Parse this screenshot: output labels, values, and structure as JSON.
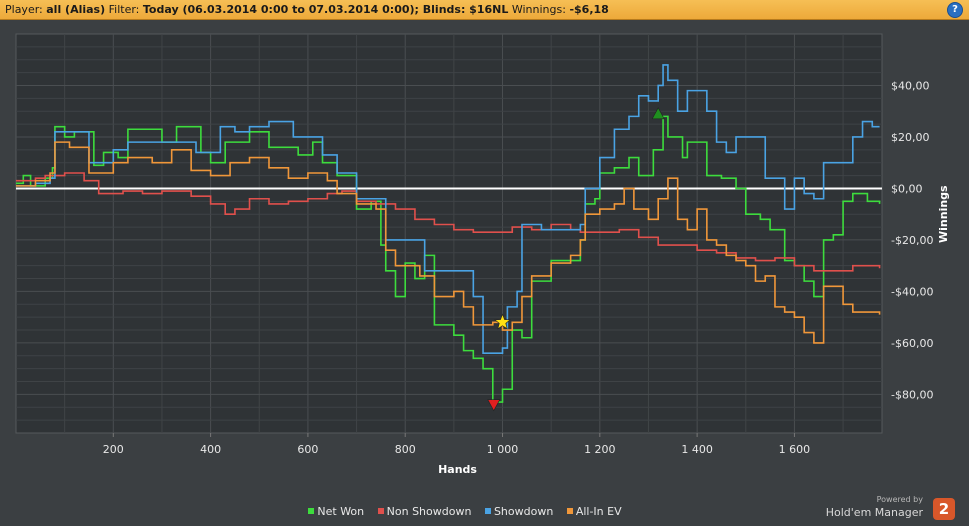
{
  "header": {
    "player_label": "Player:",
    "player_value": "all (Alias)",
    "filter_label": "Filter:",
    "filter_value": "Today (06.03.2014 0:00 to 07.03.2014 0:00); Blinds: $16NL",
    "winnings_label": "Winnings:",
    "winnings_value": "-$6,18",
    "help_glyph": "?"
  },
  "branding": {
    "powered": "Powered by",
    "name": "Hold'em Manager",
    "logo": "2"
  },
  "chart_data": {
    "type": "line",
    "xlabel": "Hands",
    "ylabel": "Winnings",
    "xlim": [
      0,
      1780
    ],
    "ylim": [
      -95,
      60
    ],
    "xticks": [
      200,
      400,
      600,
      800,
      1000,
      1200,
      1400,
      1600
    ],
    "xtick_labels": [
      "200",
      "400",
      "600",
      "800",
      "1 000",
      "1 200",
      "1 400",
      "1 600"
    ],
    "yticks": [
      40,
      20,
      0,
      -20,
      -40,
      -60,
      -80
    ],
    "ytick_labels": [
      "$40,00",
      "$20,00",
      "$0,00",
      "-$20,00",
      "-$40,00",
      "-$60,00",
      "-$80,00"
    ],
    "grid": true,
    "legend_position": "bottom-center",
    "series": [
      {
        "name": "Net Won",
        "color": "#3ddc3d",
        "points": [
          [
            0,
            2
          ],
          [
            15,
            5
          ],
          [
            30,
            1
          ],
          [
            60,
            4
          ],
          [
            75,
            8
          ],
          [
            80,
            24
          ],
          [
            100,
            20
          ],
          [
            120,
            22
          ],
          [
            160,
            9
          ],
          [
            180,
            14
          ],
          [
            210,
            12
          ],
          [
            230,
            23
          ],
          [
            300,
            18
          ],
          [
            330,
            24
          ],
          [
            380,
            14
          ],
          [
            400,
            10
          ],
          [
            430,
            18
          ],
          [
            480,
            22
          ],
          [
            520,
            16
          ],
          [
            580,
            13
          ],
          [
            610,
            18
          ],
          [
            630,
            10
          ],
          [
            660,
            5
          ],
          [
            700,
            -8
          ],
          [
            730,
            -5
          ],
          [
            750,
            -22
          ],
          [
            760,
            -32
          ],
          [
            780,
            -42
          ],
          [
            800,
            -29
          ],
          [
            820,
            -35
          ],
          [
            840,
            -26
          ],
          [
            860,
            -53
          ],
          [
            900,
            -57
          ],
          [
            920,
            -63
          ],
          [
            940,
            -66
          ],
          [
            960,
            -70
          ],
          [
            980,
            -83
          ],
          [
            1000,
            -78
          ],
          [
            1020,
            -55
          ],
          [
            1040,
            -58
          ],
          [
            1060,
            -36
          ],
          [
            1100,
            -28
          ],
          [
            1130,
            -28
          ],
          [
            1160,
            -20
          ],
          [
            1170,
            -6
          ],
          [
            1190,
            -4
          ],
          [
            1200,
            6
          ],
          [
            1230,
            8
          ],
          [
            1260,
            12
          ],
          [
            1280,
            5
          ],
          [
            1310,
            15
          ],
          [
            1330,
            28
          ],
          [
            1340,
            20
          ],
          [
            1370,
            12
          ],
          [
            1380,
            18
          ],
          [
            1420,
            5
          ],
          [
            1450,
            4
          ],
          [
            1480,
            0
          ],
          [
            1500,
            -10
          ],
          [
            1530,
            -12
          ],
          [
            1550,
            -16
          ],
          [
            1580,
            -28
          ],
          [
            1600,
            -30
          ],
          [
            1620,
            -36
          ],
          [
            1640,
            -42
          ],
          [
            1660,
            -20
          ],
          [
            1680,
            -18
          ],
          [
            1700,
            -5
          ],
          [
            1720,
            -2
          ],
          [
            1750,
            -5
          ],
          [
            1775,
            -6
          ]
        ]
      },
      {
        "name": "Non Showdown",
        "color": "#e0504c",
        "points": [
          [
            0,
            3
          ],
          [
            40,
            4
          ],
          [
            60,
            5
          ],
          [
            100,
            6
          ],
          [
            140,
            3
          ],
          [
            170,
            -2
          ],
          [
            220,
            -1
          ],
          [
            260,
            -2
          ],
          [
            300,
            -1
          ],
          [
            360,
            -3
          ],
          [
            400,
            -6
          ],
          [
            430,
            -10
          ],
          [
            450,
            -8
          ],
          [
            480,
            -4
          ],
          [
            520,
            -6
          ],
          [
            560,
            -5
          ],
          [
            600,
            -4
          ],
          [
            640,
            -2
          ],
          [
            670,
            -1
          ],
          [
            700,
            -5
          ],
          [
            740,
            -6
          ],
          [
            780,
            -8
          ],
          [
            820,
            -12
          ],
          [
            860,
            -14
          ],
          [
            900,
            -16
          ],
          [
            940,
            -17
          ],
          [
            980,
            -17
          ],
          [
            1020,
            -15
          ],
          [
            1060,
            -16
          ],
          [
            1100,
            -14
          ],
          [
            1140,
            -16
          ],
          [
            1160,
            -17
          ],
          [
            1200,
            -17
          ],
          [
            1240,
            -16
          ],
          [
            1280,
            -19
          ],
          [
            1320,
            -22
          ],
          [
            1360,
            -22
          ],
          [
            1400,
            -24
          ],
          [
            1440,
            -25
          ],
          [
            1480,
            -27
          ],
          [
            1520,
            -28
          ],
          [
            1560,
            -27
          ],
          [
            1600,
            -30
          ],
          [
            1640,
            -32
          ],
          [
            1680,
            -32
          ],
          [
            1720,
            -30
          ],
          [
            1750,
            -30
          ],
          [
            1775,
            -31
          ]
        ]
      },
      {
        "name": "Showdown",
        "color": "#4aa3e4",
        "points": [
          [
            0,
            1
          ],
          [
            40,
            2
          ],
          [
            70,
            4
          ],
          [
            80,
            22
          ],
          [
            110,
            22
          ],
          [
            150,
            10
          ],
          [
            200,
            15
          ],
          [
            230,
            18
          ],
          [
            280,
            18
          ],
          [
            300,
            18
          ],
          [
            340,
            18
          ],
          [
            370,
            14
          ],
          [
            420,
            24
          ],
          [
            450,
            22
          ],
          [
            480,
            24
          ],
          [
            520,
            26
          ],
          [
            570,
            20
          ],
          [
            610,
            20
          ],
          [
            630,
            13
          ],
          [
            660,
            6
          ],
          [
            700,
            -4
          ],
          [
            740,
            -4
          ],
          [
            760,
            -20
          ],
          [
            790,
            -20
          ],
          [
            820,
            -20
          ],
          [
            840,
            -32
          ],
          [
            880,
            -32
          ],
          [
            920,
            -32
          ],
          [
            940,
            -42
          ],
          [
            960,
            -64
          ],
          [
            1000,
            -62
          ],
          [
            1010,
            -46
          ],
          [
            1030,
            -40
          ],
          [
            1040,
            -14
          ],
          [
            1080,
            -16
          ],
          [
            1120,
            -16
          ],
          [
            1160,
            -14
          ],
          [
            1170,
            0
          ],
          [
            1200,
            12
          ],
          [
            1230,
            23
          ],
          [
            1260,
            28
          ],
          [
            1280,
            36
          ],
          [
            1300,
            34
          ],
          [
            1320,
            40
          ],
          [
            1330,
            48
          ],
          [
            1340,
            42
          ],
          [
            1360,
            30
          ],
          [
            1380,
            38
          ],
          [
            1400,
            38
          ],
          [
            1420,
            30
          ],
          [
            1440,
            18
          ],
          [
            1460,
            14
          ],
          [
            1480,
            20
          ],
          [
            1500,
            20
          ],
          [
            1520,
            20
          ],
          [
            1540,
            4
          ],
          [
            1560,
            4
          ],
          [
            1580,
            -8
          ],
          [
            1600,
            4
          ],
          [
            1620,
            -2
          ],
          [
            1640,
            -4
          ],
          [
            1660,
            10
          ],
          [
            1700,
            10
          ],
          [
            1720,
            20
          ],
          [
            1740,
            26
          ],
          [
            1760,
            24
          ],
          [
            1775,
            24
          ]
        ]
      },
      {
        "name": "All-In EV",
        "color": "#f0973a",
        "points": [
          [
            0,
            1
          ],
          [
            40,
            3
          ],
          [
            70,
            6
          ],
          [
            80,
            18
          ],
          [
            110,
            16
          ],
          [
            150,
            6
          ],
          [
            200,
            10
          ],
          [
            230,
            12
          ],
          [
            280,
            10
          ],
          [
            320,
            15
          ],
          [
            360,
            7
          ],
          [
            400,
            5
          ],
          [
            440,
            10
          ],
          [
            480,
            12
          ],
          [
            520,
            8
          ],
          [
            560,
            4
          ],
          [
            600,
            6
          ],
          [
            640,
            3
          ],
          [
            660,
            -2
          ],
          [
            700,
            -6
          ],
          [
            740,
            -8
          ],
          [
            760,
            -24
          ],
          [
            780,
            -30
          ],
          [
            800,
            -30
          ],
          [
            830,
            -34
          ],
          [
            860,
            -42
          ],
          [
            880,
            -42
          ],
          [
            900,
            -40
          ],
          [
            920,
            -46
          ],
          [
            940,
            -53
          ],
          [
            960,
            -53
          ],
          [
            980,
            -52
          ],
          [
            1000,
            -55
          ],
          [
            1020,
            -52
          ],
          [
            1040,
            -42
          ],
          [
            1060,
            -34
          ],
          [
            1100,
            -29
          ],
          [
            1140,
            -26
          ],
          [
            1160,
            -20
          ],
          [
            1170,
            -10
          ],
          [
            1200,
            -8
          ],
          [
            1230,
            -6
          ],
          [
            1250,
            0
          ],
          [
            1270,
            -8
          ],
          [
            1300,
            -12
          ],
          [
            1320,
            -4
          ],
          [
            1340,
            4
          ],
          [
            1360,
            -12
          ],
          [
            1380,
            -16
          ],
          [
            1400,
            -8
          ],
          [
            1420,
            -20
          ],
          [
            1440,
            -22
          ],
          [
            1460,
            -26
          ],
          [
            1480,
            -28
          ],
          [
            1500,
            -30
          ],
          [
            1520,
            -36
          ],
          [
            1540,
            -34
          ],
          [
            1560,
            -46
          ],
          [
            1580,
            -48
          ],
          [
            1600,
            -50
          ],
          [
            1620,
            -56
          ],
          [
            1640,
            -60
          ],
          [
            1660,
            -38
          ],
          [
            1680,
            -38
          ],
          [
            1700,
            -45
          ],
          [
            1720,
            -48
          ],
          [
            1750,
            -48
          ],
          [
            1775,
            -49
          ]
        ]
      }
    ],
    "markers": [
      {
        "shape": "triangle-up",
        "x": 1320,
        "y": 29,
        "color": "#1f8f1f"
      },
      {
        "shape": "triangle-down",
        "x": 982,
        "y": -84,
        "color": "#e02020"
      },
      {
        "shape": "star",
        "x": 1000,
        "y": -52,
        "color": "#ffe014"
      }
    ]
  }
}
